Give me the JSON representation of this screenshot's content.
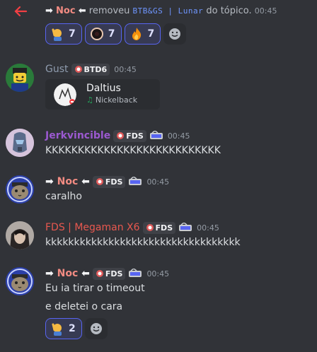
{
  "system": {
    "user": "Noc",
    "action": "removeu",
    "target": "BTB&GS | Lunar",
    "suffix": "do tópico.",
    "time": "00:45",
    "reactions": [
      {
        "emoji": "person-raising-hand-emoji",
        "count": "7"
      },
      {
        "emoji": "dark-orb-emoji",
        "count": "7"
      },
      {
        "emoji": "fire-emoji",
        "count": "7"
      }
    ]
  },
  "messages": [
    {
      "author": "Gust",
      "author_color": "#8f9cae",
      "tag": "BTD6",
      "time": "00:45",
      "embed": {
        "name": "Daltius",
        "song": "Nickelback"
      }
    },
    {
      "author": "Jerkvincible",
      "author_color": "#9b59d0",
      "tag": "FDS",
      "time": "00:45",
      "lines": [
        "KKKKKKKKKKKKKKKKKKKKKKKKKKK"
      ]
    },
    {
      "author": "Noc",
      "author_color": "#f28b82",
      "tag": "FDS",
      "time": "00:45",
      "lines": [
        "caralho"
      ]
    },
    {
      "author": "FDS | Megaman X6",
      "author_color": "#e8584f",
      "tag": "FDS",
      "time": "00:45",
      "lines": [
        "kkkkkkkkkkkkkkkkkkkkkkkkkkkkkkkkkk"
      ]
    },
    {
      "author": "Noc",
      "author_color": "#f28b82",
      "tag": "FDS",
      "time": "00:45",
      "lines": [
        "Eu ia tirar o timeout",
        "e deletei o cara"
      ],
      "reactions": [
        {
          "emoji": "person-raising-hand-emoji",
          "count": "2"
        }
      ]
    }
  ]
}
